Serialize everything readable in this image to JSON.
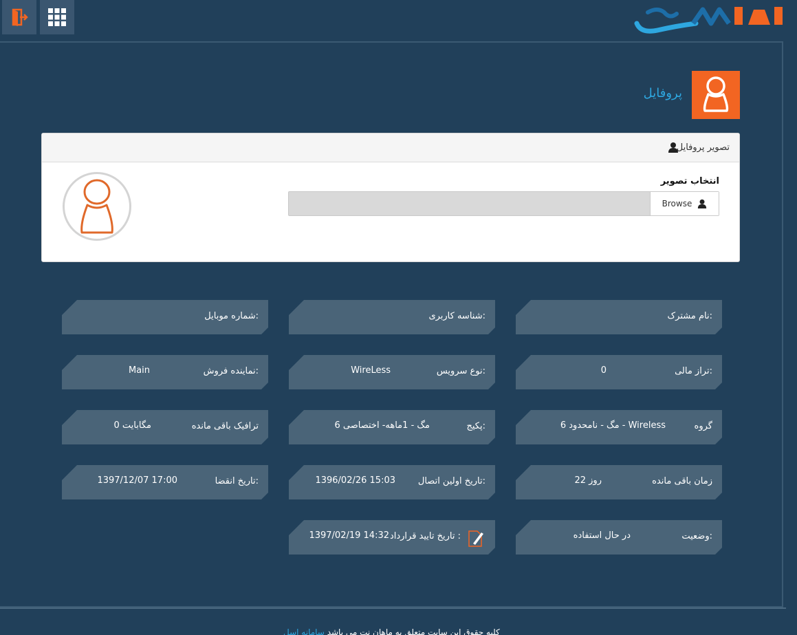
{
  "topbar": {
    "logout_icon": "logout-icon",
    "apps_icon": "grid-icon",
    "brand_color": "#2ea7e0"
  },
  "header": {
    "title": "پروفایل",
    "accent": "#f26522"
  },
  "profile_card": {
    "title": "تصویر پروفایل",
    "choose_label": "انتخاب تصویر",
    "browse_label": "Browse"
  },
  "info": {
    "subscriber_name": {
      "label": "نام مشترک:",
      "value": ""
    },
    "username": {
      "label": "شناسه کاربری:",
      "value": ""
    },
    "mobile": {
      "label": "شماره موبایل:",
      "value": ""
    },
    "balance": {
      "label": "تراز مالی:",
      "value": "0"
    },
    "service_type": {
      "label": "نوع سرویس:",
      "value": "WireLess"
    },
    "sales_rep": {
      "label": "نماینده فروش:",
      "value": "Main"
    },
    "group": {
      "label": "گروه",
      "value": "6 مگ - نامحدود - Wireless"
    },
    "package": {
      "label": "پکیج:",
      "value": "6 مگ - 1ماهه- اختصاصی"
    },
    "remaining_traffic": {
      "label": "ترافیک باقی مانده",
      "value": "0 مگابایت"
    },
    "remaining_time": {
      "label": "زمان باقی مانده",
      "value": "22 روز"
    },
    "first_connection": {
      "label": "تاریخ اولین اتصال:",
      "value": "1396/02/26 15:03"
    },
    "expiry_date": {
      "label": "تاریخ انقضا:",
      "value": "1397/12/07 17:00"
    },
    "status": {
      "label": "وضعیت:",
      "value": "در حال استفاده"
    },
    "contract_date": {
      "label": "تاریخ تایید قرارداد :",
      "value": "1397/02/19 14:32"
    }
  },
  "footer": {
    "link_text": "سامانه اسل",
    "text": "کلیه حقوق این سایت متعلق به ماهان نت می باشد"
  }
}
